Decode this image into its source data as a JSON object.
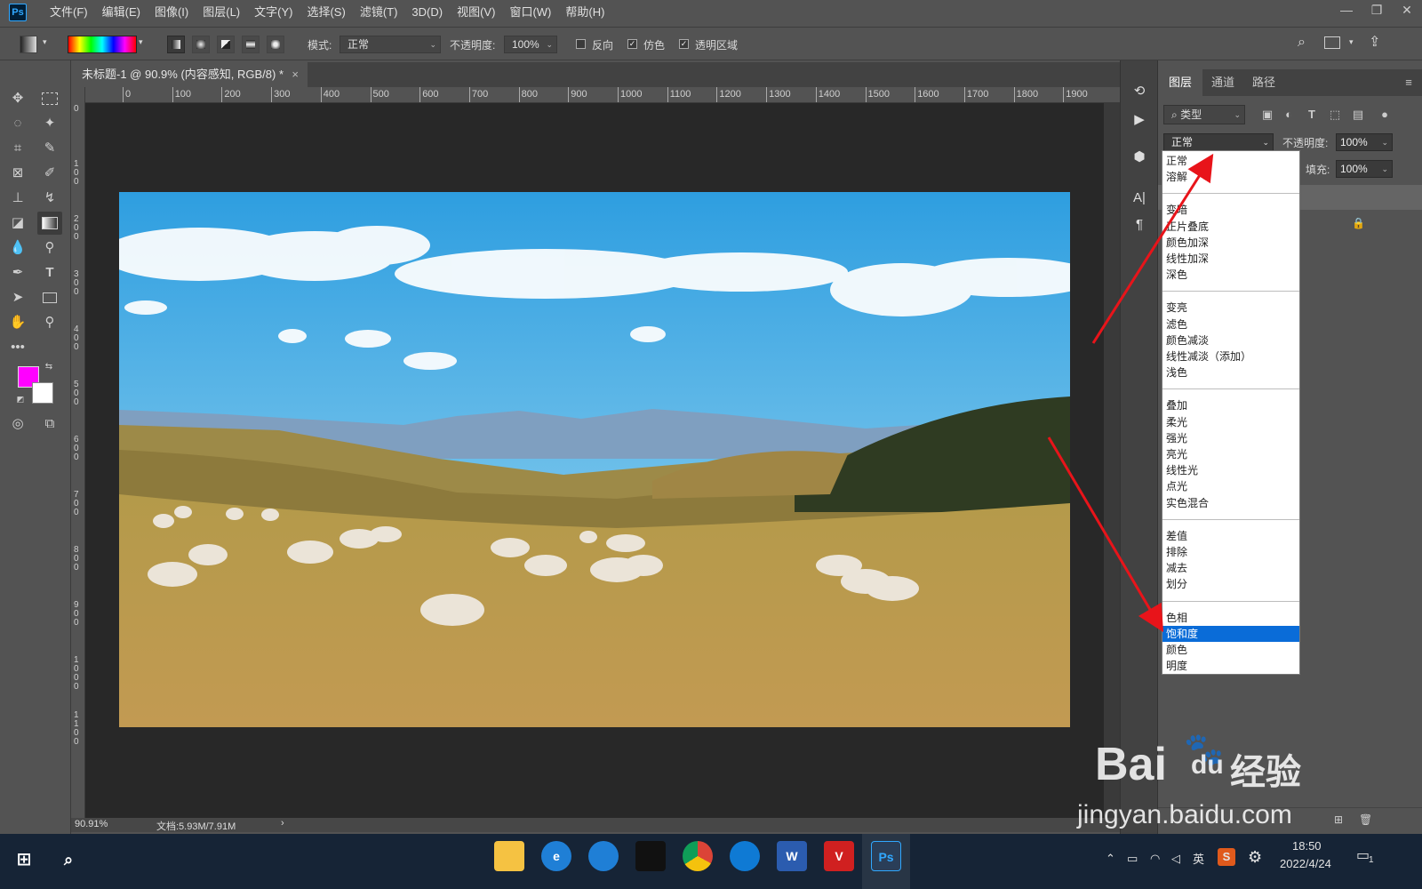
{
  "menubar": {
    "logo": "Ps",
    "items": [
      "文件(F)",
      "编辑(E)",
      "图像(I)",
      "图层(L)",
      "文字(Y)",
      "选择(S)",
      "滤镜(T)",
      "3D(D)",
      "视图(V)",
      "窗口(W)",
      "帮助(H)"
    ],
    "window_controls": [
      "—",
      "❐",
      "✕"
    ]
  },
  "options": {
    "mode_label": "模式:",
    "mode_value": "正常",
    "opacity_label": "不透明度:",
    "opacity_value": "100%",
    "reverse_label": "反向",
    "dither_label": "仿色",
    "transparency_label": "透明区域",
    "reverse_checked": false,
    "dither_checked": true,
    "transparency_checked": true
  },
  "document": {
    "tab_title": "未标题-1 @ 90.9% (内容感知, RGB/8) *",
    "tab_close": "×",
    "ruler_marks": [
      "0",
      "100",
      "200",
      "300",
      "400",
      "500",
      "600",
      "700",
      "800",
      "900",
      "1000",
      "1100",
      "1200",
      "1300",
      "1400",
      "1500",
      "1600",
      "1700",
      "1800",
      "1900"
    ],
    "vruler_marks": [
      "0",
      "100",
      "200",
      "300",
      "400",
      "500",
      "600",
      "700",
      "800",
      "900",
      "1000",
      "1100"
    ],
    "zoom": "90.91%",
    "doc_info": "文档:5.93M/7.91M",
    "status_arrow": "›"
  },
  "colors": {
    "foreground": "#ff00ff",
    "background": "#ffffff",
    "selection_accent": "#0a6cd8",
    "annotation_arrow": "#e8141a"
  },
  "layers_panel": {
    "tabs": [
      "图层",
      "通道",
      "路径"
    ],
    "active_tab": "图层",
    "filter_label": "类型",
    "blend_mode": "正常",
    "opacity_label": "不透明度:",
    "opacity_value": "100%",
    "fill_label": "填充:",
    "fill_value": "100%"
  },
  "blend_dropdown": {
    "groups": [
      [
        "正常",
        "溶解"
      ],
      [
        "变暗",
        "正片叠底",
        "颜色加深",
        "线性加深",
        "深色"
      ],
      [
        "变亮",
        "滤色",
        "颜色减淡",
        "线性减淡（添加）",
        "浅色"
      ],
      [
        "叠加",
        "柔光",
        "强光",
        "亮光",
        "线性光",
        "点光",
        "实色混合"
      ],
      [
        "差值",
        "排除",
        "减去",
        "划分"
      ],
      [
        "色相",
        "饱和度",
        "颜色",
        "明度"
      ]
    ],
    "selected": "饱和度"
  },
  "watermark": {
    "brand": "Bai",
    "brand2": "du",
    "cn": "经验",
    "url": "jingyan.baidu.com"
  },
  "taskbar": {
    "apps": [
      "file-explorer",
      "ie",
      "qq-browser",
      "qq",
      "chrome",
      "edge",
      "word",
      "wps",
      "photoshop"
    ],
    "app_labels": [
      "",
      "e",
      "",
      "",
      "",
      "",
      "W",
      "V",
      "Ps"
    ],
    "tray_ime": "英",
    "time": "18:50",
    "date": "2022/4/24",
    "notification_count": "1"
  }
}
